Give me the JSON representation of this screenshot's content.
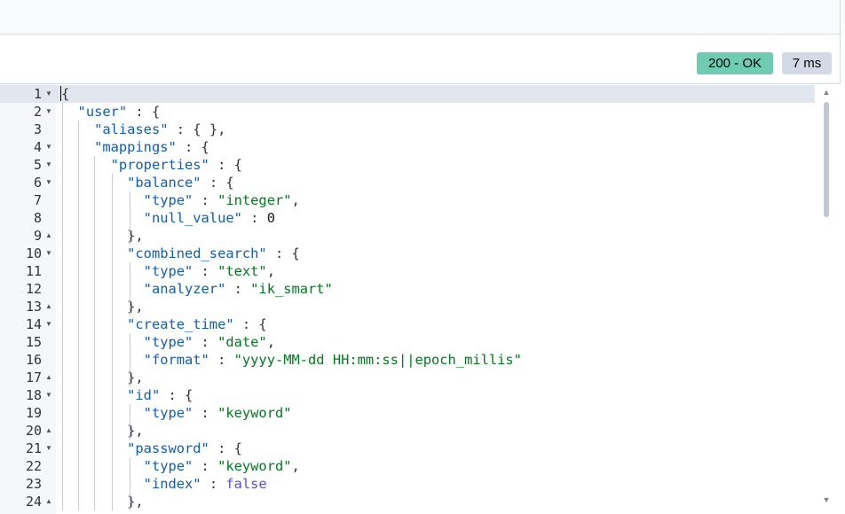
{
  "response": {
    "status": "200 - OK",
    "time": "7 ms"
  },
  "editor": {
    "lines": [
      {
        "num": "1",
        "fold": "open",
        "tokens": [
          [
            "p",
            "{"
          ]
        ]
      },
      {
        "num": "2",
        "fold": "open",
        "tokens": [
          [
            "p",
            "  "
          ],
          [
            "k",
            "\"user\""
          ],
          [
            "p",
            " : {"
          ]
        ]
      },
      {
        "num": "3",
        "fold": "",
        "tokens": [
          [
            "p",
            "    "
          ],
          [
            "k",
            "\"aliases\""
          ],
          [
            "p",
            " : { },"
          ]
        ]
      },
      {
        "num": "4",
        "fold": "open",
        "tokens": [
          [
            "p",
            "    "
          ],
          [
            "k",
            "\"mappings\""
          ],
          [
            "p",
            " : {"
          ]
        ]
      },
      {
        "num": "5",
        "fold": "open",
        "tokens": [
          [
            "p",
            "      "
          ],
          [
            "k",
            "\"properties\""
          ],
          [
            "p",
            " : {"
          ]
        ]
      },
      {
        "num": "6",
        "fold": "open",
        "tokens": [
          [
            "p",
            "        "
          ],
          [
            "k",
            "\"balance\""
          ],
          [
            "p",
            " : {"
          ]
        ]
      },
      {
        "num": "7",
        "fold": "",
        "tokens": [
          [
            "p",
            "          "
          ],
          [
            "k",
            "\"type\""
          ],
          [
            "p",
            " : "
          ],
          [
            "s",
            "\"integer\""
          ],
          [
            "p",
            ","
          ]
        ]
      },
      {
        "num": "8",
        "fold": "",
        "tokens": [
          [
            "p",
            "          "
          ],
          [
            "k",
            "\"null_value\""
          ],
          [
            "p",
            " : "
          ],
          [
            "n",
            "0"
          ]
        ]
      },
      {
        "num": "9",
        "fold": "close",
        "tokens": [
          [
            "p",
            "        },"
          ]
        ]
      },
      {
        "num": "10",
        "fold": "open",
        "tokens": [
          [
            "p",
            "        "
          ],
          [
            "k",
            "\"combined_search\""
          ],
          [
            "p",
            " : {"
          ]
        ]
      },
      {
        "num": "11",
        "fold": "",
        "tokens": [
          [
            "p",
            "          "
          ],
          [
            "k",
            "\"type\""
          ],
          [
            "p",
            " : "
          ],
          [
            "s",
            "\"text\""
          ],
          [
            "p",
            ","
          ]
        ]
      },
      {
        "num": "12",
        "fold": "",
        "tokens": [
          [
            "p",
            "          "
          ],
          [
            "k",
            "\"analyzer\""
          ],
          [
            "p",
            " : "
          ],
          [
            "s",
            "\"ik_smart\""
          ]
        ]
      },
      {
        "num": "13",
        "fold": "close",
        "tokens": [
          [
            "p",
            "        },"
          ]
        ]
      },
      {
        "num": "14",
        "fold": "open",
        "tokens": [
          [
            "p",
            "        "
          ],
          [
            "k",
            "\"create_time\""
          ],
          [
            "p",
            " : {"
          ]
        ]
      },
      {
        "num": "15",
        "fold": "",
        "tokens": [
          [
            "p",
            "          "
          ],
          [
            "k",
            "\"type\""
          ],
          [
            "p",
            " : "
          ],
          [
            "s",
            "\"date\""
          ],
          [
            "p",
            ","
          ]
        ]
      },
      {
        "num": "16",
        "fold": "",
        "tokens": [
          [
            "p",
            "          "
          ],
          [
            "k",
            "\"format\""
          ],
          [
            "p",
            " : "
          ],
          [
            "s",
            "\"yyyy-MM-dd HH:mm:ss||epoch_millis\""
          ]
        ]
      },
      {
        "num": "17",
        "fold": "close",
        "tokens": [
          [
            "p",
            "        },"
          ]
        ]
      },
      {
        "num": "18",
        "fold": "open",
        "tokens": [
          [
            "p",
            "        "
          ],
          [
            "k",
            "\"id\""
          ],
          [
            "p",
            " : {"
          ]
        ]
      },
      {
        "num": "19",
        "fold": "",
        "tokens": [
          [
            "p",
            "          "
          ],
          [
            "k",
            "\"type\""
          ],
          [
            "p",
            " : "
          ],
          [
            "s",
            "\"keyword\""
          ]
        ]
      },
      {
        "num": "20",
        "fold": "close",
        "tokens": [
          [
            "p",
            "        },"
          ]
        ]
      },
      {
        "num": "21",
        "fold": "open",
        "tokens": [
          [
            "p",
            "        "
          ],
          [
            "k",
            "\"password\""
          ],
          [
            "p",
            " : {"
          ]
        ]
      },
      {
        "num": "22",
        "fold": "",
        "tokens": [
          [
            "p",
            "          "
          ],
          [
            "k",
            "\"type\""
          ],
          [
            "p",
            " : "
          ],
          [
            "s",
            "\"keyword\""
          ],
          [
            "p",
            ","
          ]
        ]
      },
      {
        "num": "23",
        "fold": "",
        "tokens": [
          [
            "p",
            "          "
          ],
          [
            "k",
            "\"index\""
          ],
          [
            "p",
            " : "
          ],
          [
            "b",
            "false"
          ]
        ]
      },
      {
        "num": "24",
        "fold": "close",
        "tokens": [
          [
            "p",
            "        },"
          ]
        ]
      }
    ]
  }
}
